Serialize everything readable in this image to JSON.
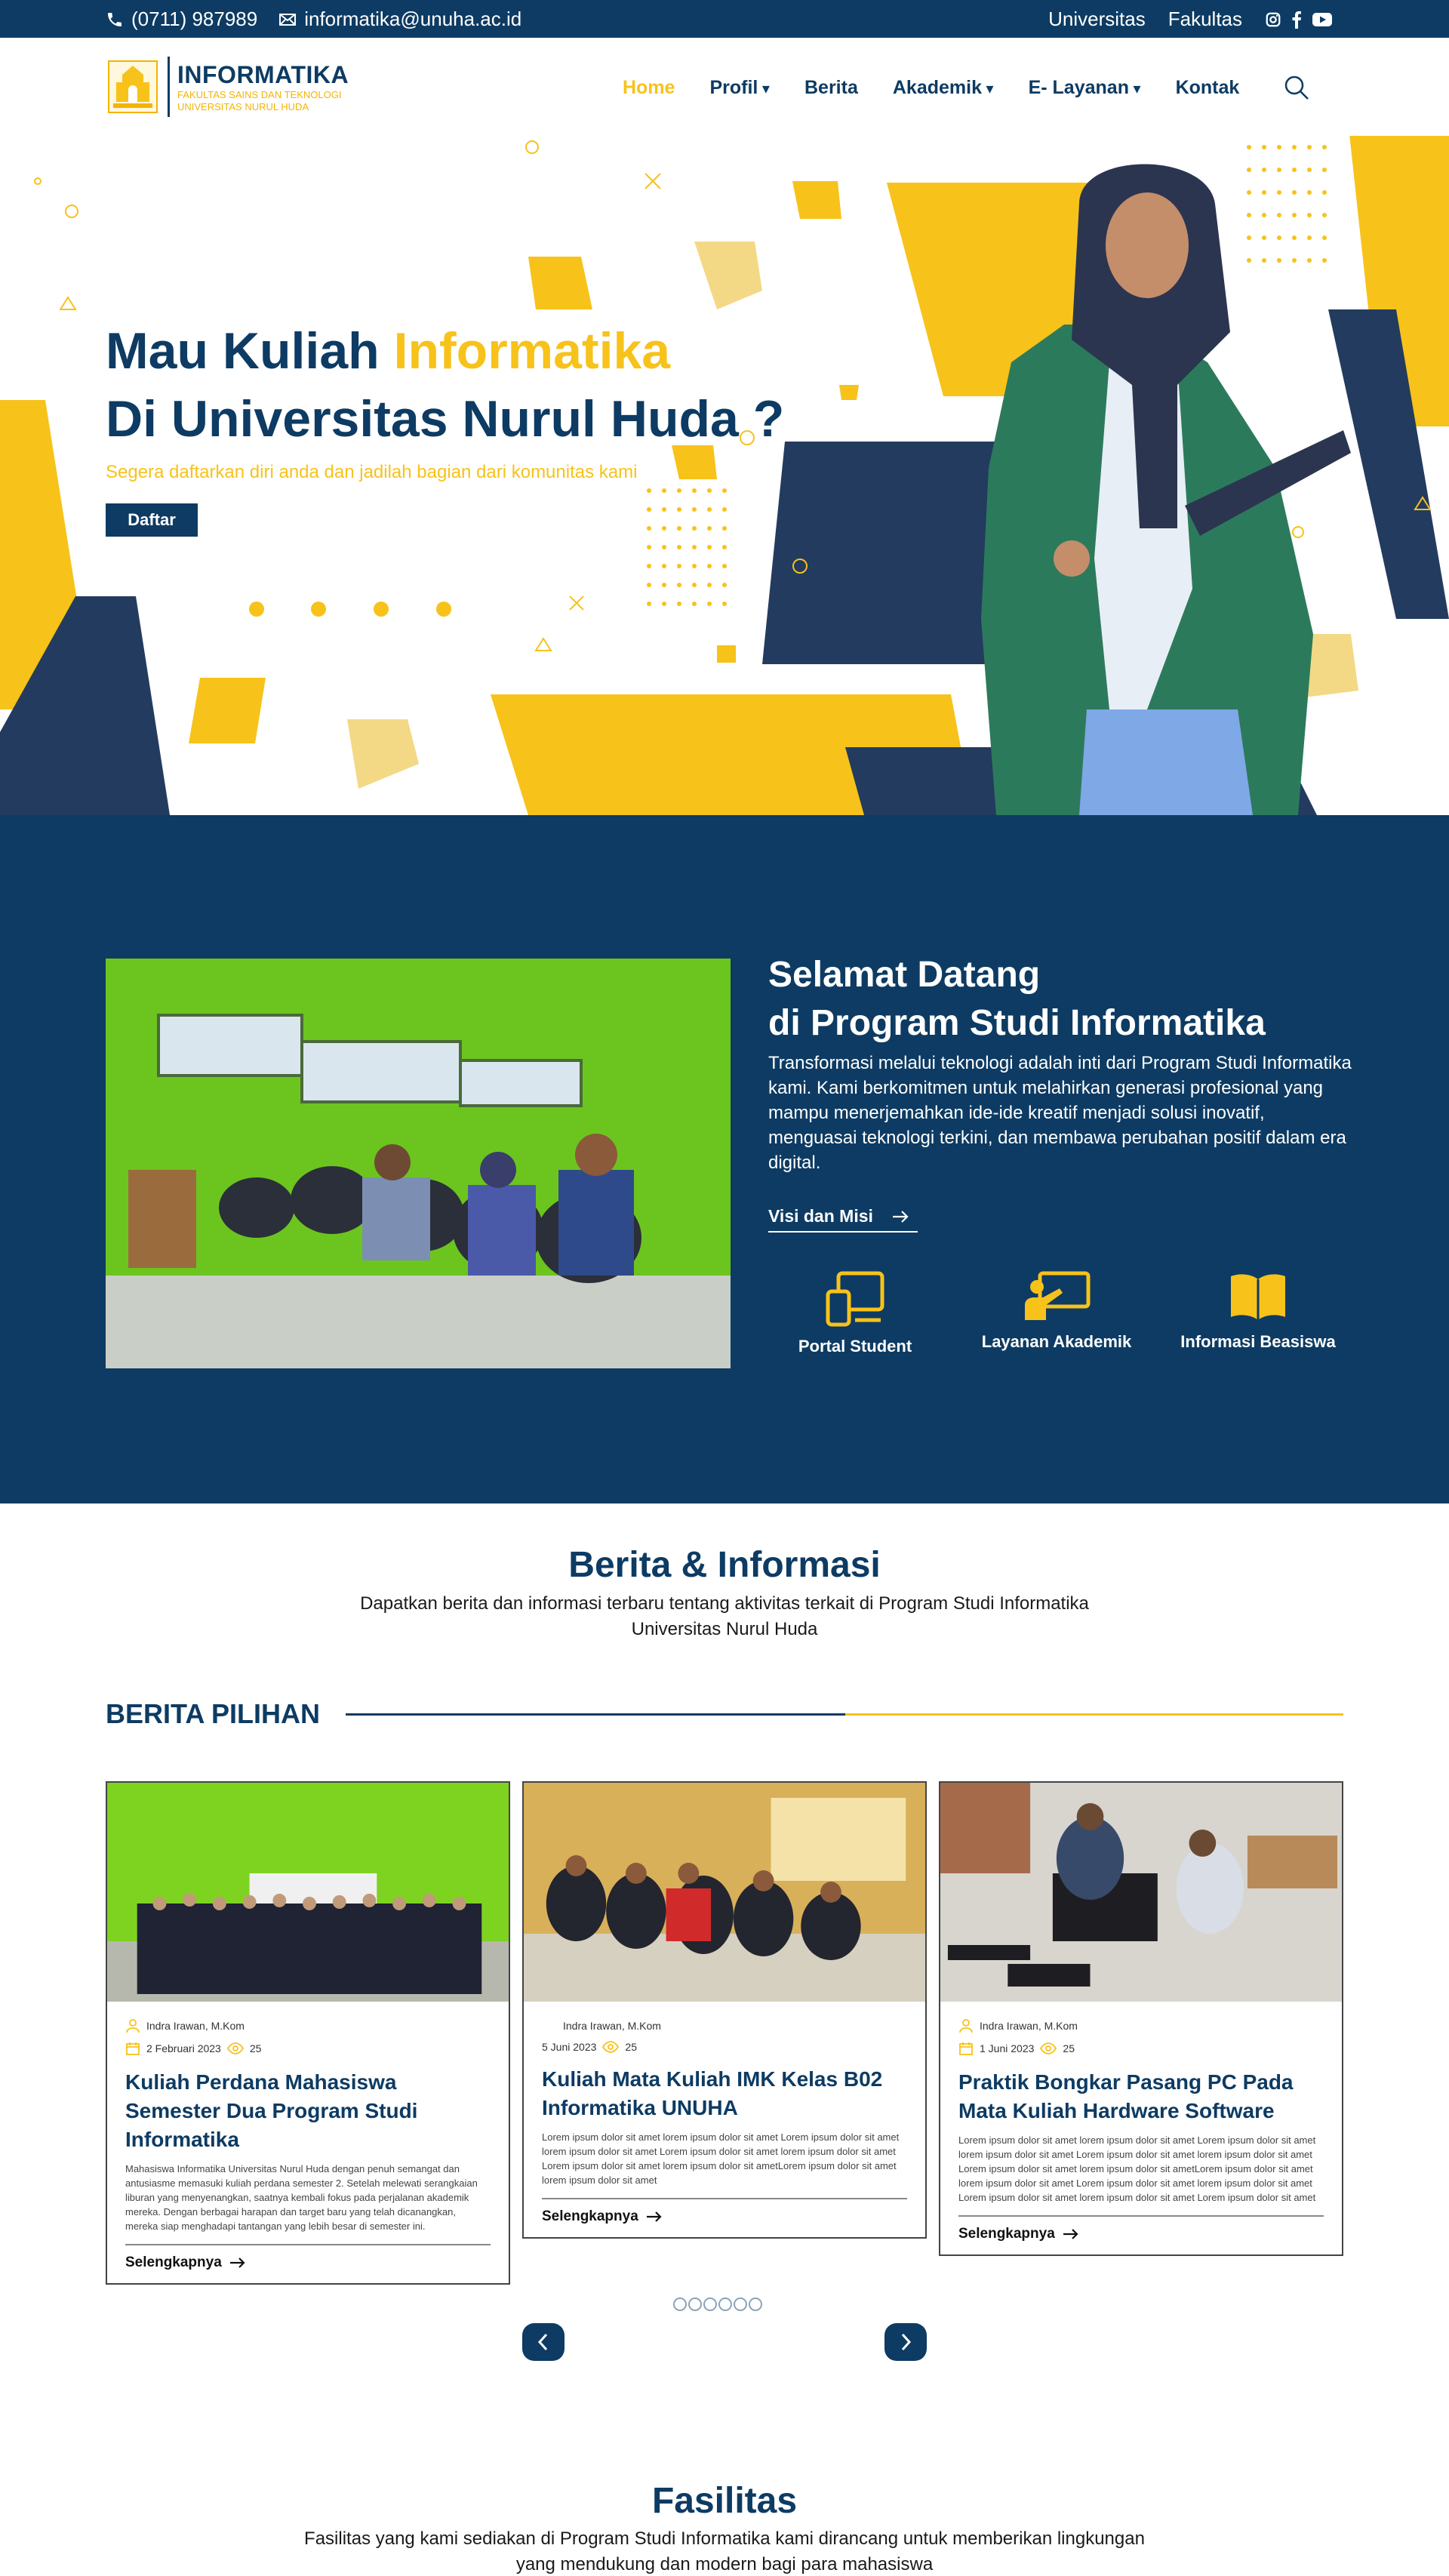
{
  "topbar": {
    "phone": "(0711) 987989",
    "email": "informatika@unuha.ac.id",
    "links": [
      "Universitas",
      "Fakultas"
    ],
    "socials": [
      "instagram-icon",
      "facebook-icon",
      "youtube-icon"
    ]
  },
  "header": {
    "brand": "INFORMATIKA",
    "brand_sub1": "FAKULTAS SAINS DAN TEKNOLOGI",
    "brand_sub2": "UNIVERSITAS NURUL HUDA",
    "nav": [
      {
        "label": "Home",
        "active": true
      },
      {
        "label": "Profil",
        "dropdown": true
      },
      {
        "label": "Berita"
      },
      {
        "label": "Akademik",
        "dropdown": true
      },
      {
        "label": "E- Layanan",
        "dropdown": true
      },
      {
        "label": "Kontak"
      }
    ]
  },
  "hero": {
    "title_part1": "Mau Kuliah ",
    "title_highlight": "Informatika",
    "title_line2": "Di Universitas Nurul Huda ?",
    "subtitle": "Segera daftarkan diri anda dan jadilah bagian dari komunitas kami",
    "button": "Daftar"
  },
  "welcome": {
    "title_line1": "Selamat Datang",
    "title_line2": "di Program Studi Informatika",
    "body": "Transformasi melalui teknologi adalah inti dari Program Studi Informatika kami. Kami berkomitmen untuk melahirkan generasi profesional yang mampu menerjemahkan ide-ide kreatif menjadi solusi inovatif, menguasai teknologi terkini, dan membawa perubahan positif dalam era digital.",
    "link": "Visi dan Misi",
    "quick": [
      {
        "label": "Portal Student",
        "icon": "devices-icon"
      },
      {
        "label": "Layanan Akademik",
        "icon": "presentation-icon"
      },
      {
        "label": "Informasi Beasiswa",
        "icon": "book-icon"
      }
    ]
  },
  "berita": {
    "title": "Berita & Informasi",
    "subtitle_line1": "Dapatkan berita dan informasi terbaru tentang aktivitas terkait di Program Studi Informatika",
    "subtitle_line2": "Universitas Nurul Huda",
    "pilihan": "BERITA PILIHAN",
    "cards": [
      {
        "author": "Indra Irawan, M.Kom",
        "date": "2 Februari 2023",
        "views": "25",
        "title": "Kuliah Perdana Mahasiswa Semester Dua Program Studi Informatika",
        "excerpt": "Mahasiswa Informatika Universitas Nurul Huda dengan penuh semangat dan antusiasme memasuki kuliah perdana semester 2. Setelah melewati serangkaian liburan yang menyenangkan, saatnya kembali fokus pada perjalanan akademik mereka. Dengan berbagai harapan dan target baru yang telah dicanangkan, mereka siap menghadapi tantangan yang lebih besar di semester ini.",
        "more": "Selengkapnya"
      },
      {
        "author": "Indra Irawan, M.Kom",
        "date": "5 Juni 2023",
        "views": "25",
        "title": "Kuliah Mata Kuliah IMK Kelas B02 Informatika UNUHA",
        "excerpt": "Lorem ipsum dolor sit amet lorem ipsum dolor sit amet Lorem ipsum dolor sit amet lorem ipsum dolor sit amet Lorem ipsum dolor sit amet lorem ipsum dolor sit amet Lorem ipsum dolor sit amet lorem ipsum dolor sit ametLorem ipsum dolor sit amet lorem ipsum dolor sit amet",
        "more": "Selengkapnya"
      },
      {
        "author": "Indra Irawan, M.Kom",
        "date": "1 Juni 2023",
        "views": "25",
        "title": "Praktik Bongkar Pasang PC Pada Mata Kuliah Hardware Software",
        "excerpt": "Lorem ipsum dolor sit amet lorem ipsum dolor sit amet Lorem ipsum dolor sit amet lorem ipsum dolor sit amet Lorem ipsum dolor sit amet lorem ipsum dolor sit amet Lorem ipsum dolor sit amet lorem ipsum dolor sit ametLorem ipsum dolor sit amet lorem ipsum dolor sit amet Lorem ipsum dolor sit amet lorem ipsum dolor sit amet Lorem ipsum dolor sit amet lorem ipsum dolor sit amet Lorem ipsum dolor sit amet lorem ipsum dolor sit amet",
        "more": "Selengkapnya"
      }
    ]
  },
  "fasilitas": {
    "title": "Fasilitas",
    "subtitle_line1": "Fasilitas yang kami sediakan di Program Studi Informatika kami dirancang untuk memberikan lingkungan",
    "subtitle_line2": "yang mendukung dan modern bagi para mahasiswa"
  },
  "colors": {
    "navy": "#0d3b63",
    "yellow": "#f7c21a"
  }
}
